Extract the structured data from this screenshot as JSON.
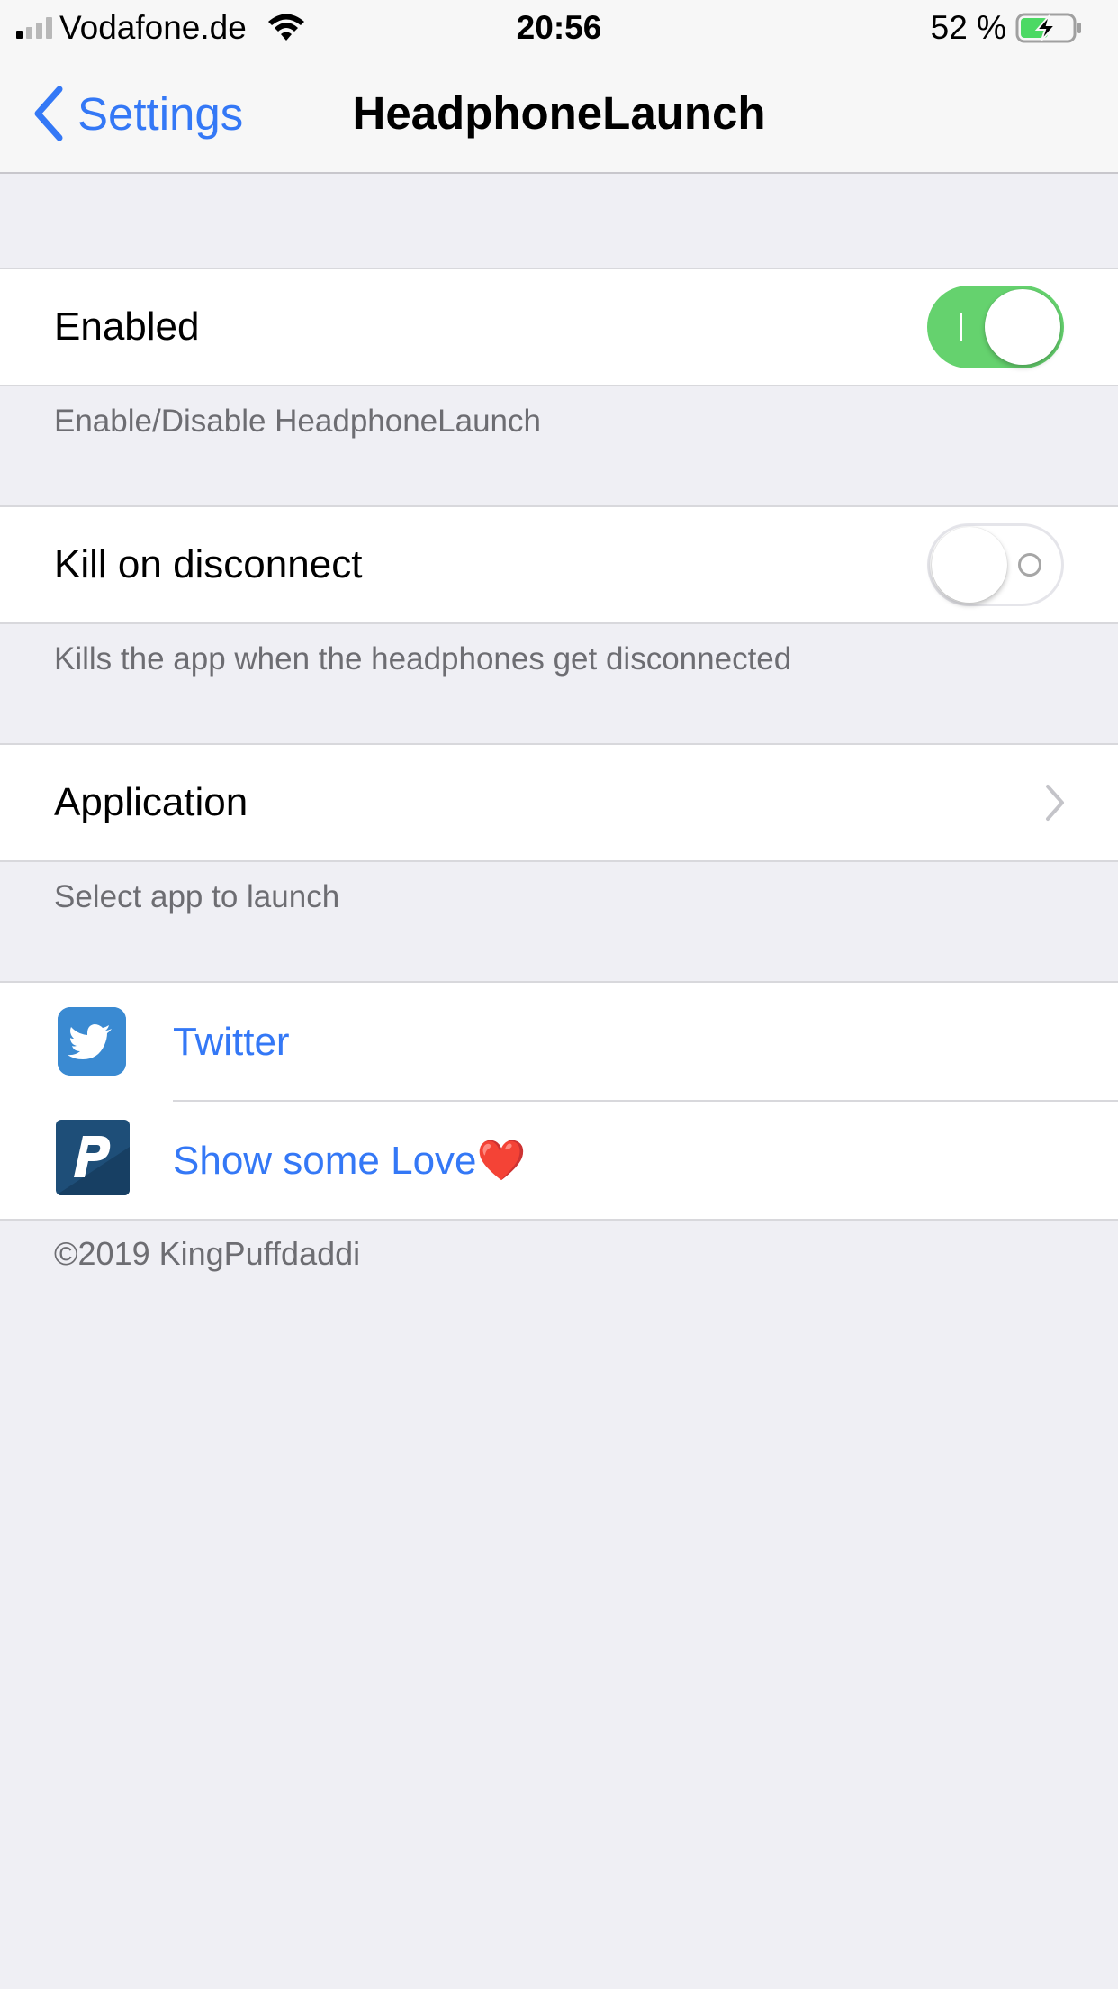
{
  "status_bar": {
    "carrier": "Vodafone.de",
    "time": "20:56",
    "battery_percent": "52 %",
    "battery_level": 0.52,
    "signal_bars_active": 1
  },
  "nav": {
    "back_label": "Settings",
    "title": "HeadphoneLaunch"
  },
  "sections": {
    "enabled": {
      "label": "Enabled",
      "value": true,
      "footer": "Enable/Disable HeadphoneLaunch"
    },
    "kill": {
      "label": "Kill on disconnect",
      "value": false,
      "footer": "Kills the app when the headphones get disconnected"
    },
    "application": {
      "label": "Application",
      "footer": "Select app to launch"
    },
    "links": {
      "twitter": {
        "label": "Twitter",
        "icon": "twitter-icon"
      },
      "donate": {
        "label": "Show some Love",
        "emoji": "❤️",
        "icon": "paypal-icon"
      }
    },
    "copyright": "©2019 KingPuffdaddi"
  },
  "colors": {
    "accent": "#3478f6",
    "toggle_on": "#65d26e",
    "background": "#efeff4"
  }
}
